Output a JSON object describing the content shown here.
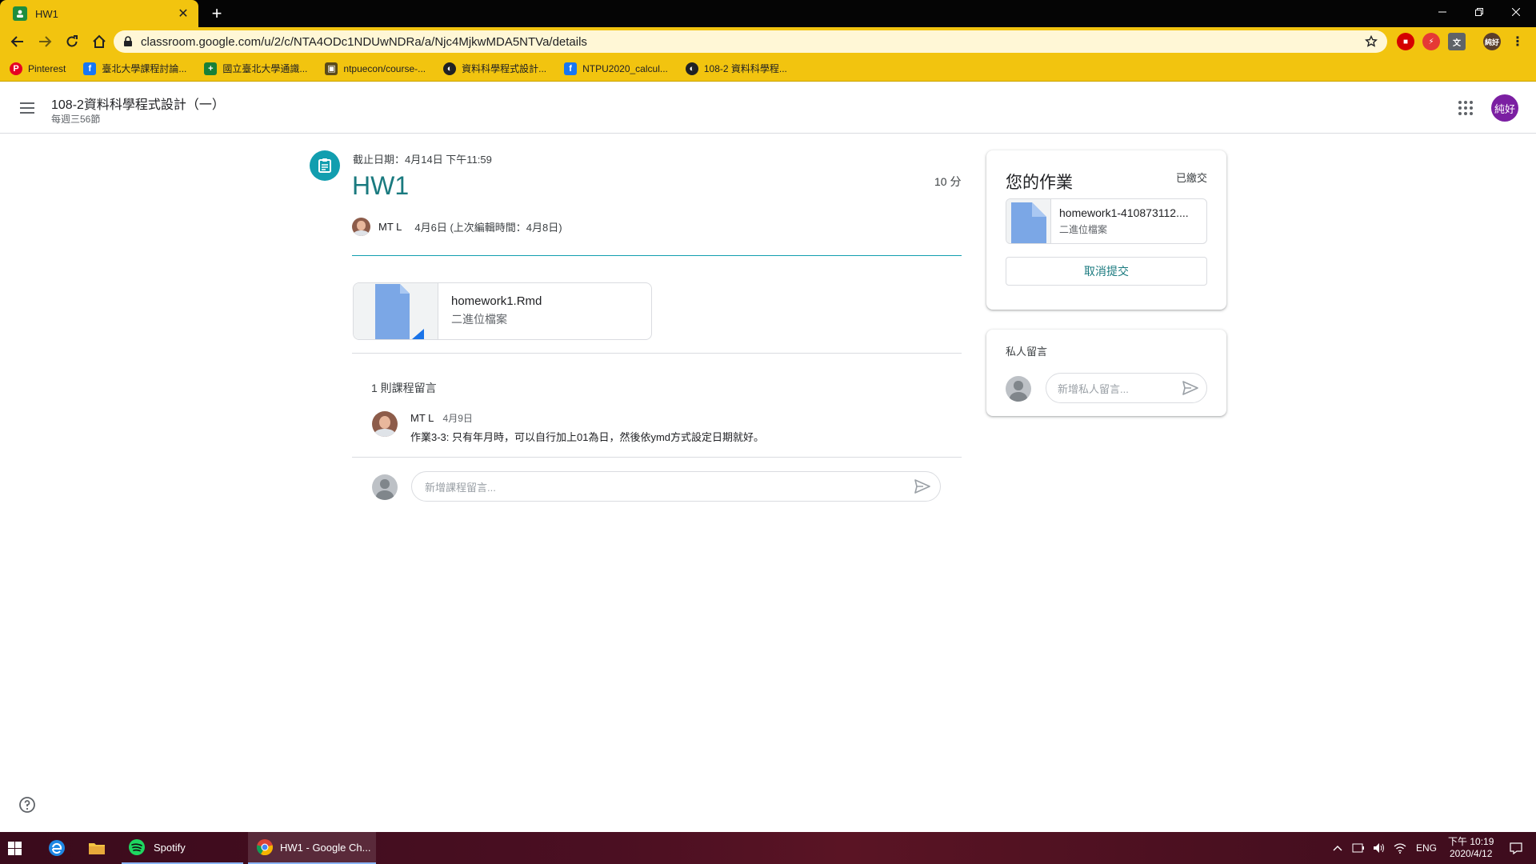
{
  "browser": {
    "tab_title": "HW1",
    "url": "classroom.google.com/u/2/c/NTA4ODc1NDUwNDRa/a/Njc4MjkwMDA5NTVa/details",
    "profile_label": "純好",
    "bookmarks": [
      {
        "label": "Pinterest",
        "icon": "pinterest-icon",
        "color": "#e60023",
        "glyph": "P"
      },
      {
        "label": "臺北大學課程討論...",
        "icon": "facebook-icon",
        "color": "#1877f2",
        "glyph": "f"
      },
      {
        "label": "國立臺北大學通識...",
        "icon": "sheets-icon",
        "color": "#188038",
        "glyph": "+"
      },
      {
        "label": "ntpuecon/course-...",
        "icon": "github-icon",
        "color": "#5a4a1a",
        "glyph": "▣"
      },
      {
        "label": "資料科學程式設計...",
        "icon": "globe-icon",
        "color": "#202124",
        "glyph": "◐"
      },
      {
        "label": "NTPU2020_calcul...",
        "icon": "facebook-icon",
        "color": "#1877f2",
        "glyph": "f"
      },
      {
        "label": "108-2 資料科學程...",
        "icon": "globe-icon",
        "color": "#202124",
        "glyph": "◐"
      }
    ]
  },
  "course": {
    "title": "108-2資料科學程式設計（一）",
    "subtitle": "每週三56節",
    "user_avatar": "純好"
  },
  "assignment": {
    "due": "截止日期：4月14日 下午11:59",
    "title": "HW1",
    "points": "10 分",
    "author": "MT L",
    "posted": "4月6日 (上次編輯時間：4月8日)",
    "attachment": {
      "name": "homework1.Rmd",
      "type": "二進位檔案"
    }
  },
  "comments": {
    "header": "1 則課程留言",
    "items": [
      {
        "author": "MT L",
        "date": "4月9日",
        "text": "作業3-3: 只有年月時，可以自行加上01為日，然後依ymd方式設定日期就好。"
      }
    ],
    "placeholder": "新增課程留言..."
  },
  "your_work": {
    "title": "您的作業",
    "status": "已繳交",
    "file_name": "homework1-410873112....",
    "file_type": "二進位檔案",
    "unsubmit_label": "取消提交"
  },
  "private_comments": {
    "title": "私人留言",
    "placeholder": "新增私人留言..."
  },
  "taskbar": {
    "spotify_label": "Spotify",
    "chrome_label": "HW1 - Google Ch...",
    "lang": "ENG",
    "time": "下午 10:19",
    "date": "2020/4/12"
  },
  "colors": {
    "accent": "#129eaf",
    "browser_frame": "#f2c40f",
    "title_teal": "#1a7a7f",
    "avatar": "#7b1fa2"
  }
}
